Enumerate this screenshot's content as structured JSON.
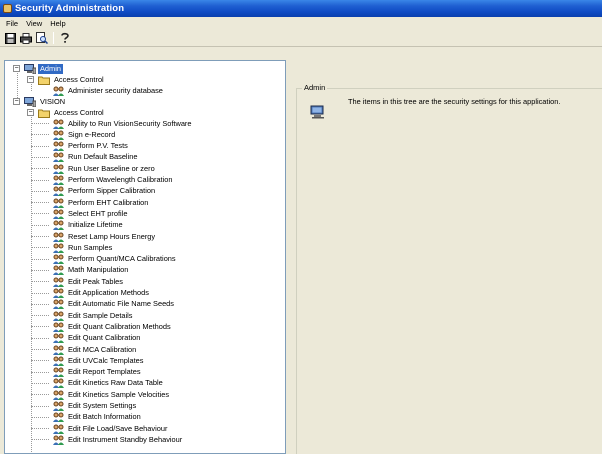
{
  "window": {
    "title": "Security Administration"
  },
  "menu": {
    "items": [
      "File",
      "View",
      "Help"
    ]
  },
  "toolbar": {
    "buttons": [
      "save-icon",
      "print-icon",
      "print-preview-icon",
      "help-icon"
    ]
  },
  "tree": {
    "admin": {
      "label": "Admin",
      "access_control": {
        "label": "Access Control",
        "children": [
          "Administer security database"
        ]
      }
    },
    "vision": {
      "label": "VISION",
      "access_control": {
        "label": "Access Control",
        "children": [
          "Ability to Run VisionSecurity Software",
          "Sign e-Record",
          "Perform P.V. Tests",
          "Run Default Baseline",
          "Run User Baseline or zero",
          "Perform Wavelength Calibration",
          "Perform Sipper Calibration",
          "Perform EHT Calibration",
          "Select EHT profile",
          "Initialize Lifetime",
          "Reset Lamp Hours Energy",
          "Run Samples",
          "Perform Quant/MCA Calibrations",
          "Math Manipulation",
          "Edit Peak Tables",
          "Edit Application Methods",
          "Edit Automatic File Name Seeds",
          "Edit Sample Details",
          "Edit Quant Calibration Methods",
          "Edit Quant Calibration",
          "Edit MCA Calibration",
          "Edit UVCalc Templates",
          "Edit Report Templates",
          "Edit Kinetics Raw Data Table",
          "Edit Kinetics Sample Velocities",
          "Edit System Settings",
          "Edit Batch Information",
          "Edit File Load/Save Behaviour",
          "Edit Instrument Standby Behaviour"
        ]
      }
    }
  },
  "detail": {
    "group_label": "Admin",
    "description": "The items in this tree are the security settings for this application."
  }
}
